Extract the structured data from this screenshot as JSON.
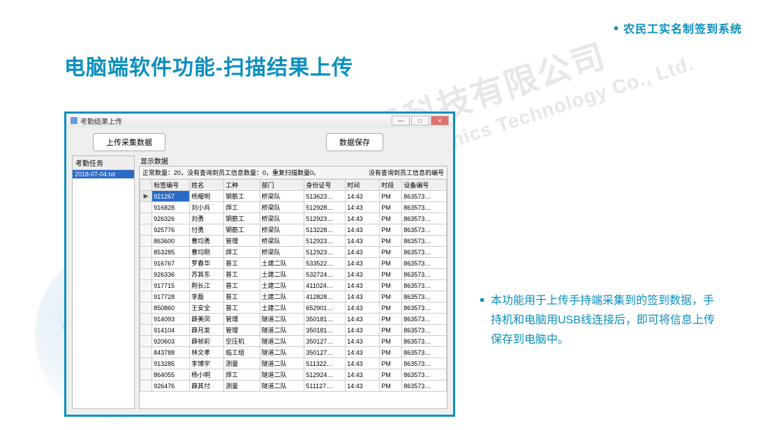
{
  "header": {
    "system_label": "农民工实名制签到系统",
    "page_title": "电脑端软件功能-扫描结果上传"
  },
  "watermark": {
    "cn": "陕西永辉电子科技有限公司",
    "en": "Shaanxi YongHui Electronics Technology Co., Ltd."
  },
  "app": {
    "window_title": "考勤结果上传",
    "btn_upload": "上传采集数据",
    "btn_save": "数据保存",
    "task_panel_header": "考勤任务",
    "task_file": "2018-07-04.txt",
    "display_label": "显示数据",
    "summary_left": "正常数量：20，没有查询到员工信息数量：0，重复扫描数量0。",
    "summary_right": "没有查询到员工信息的编号",
    "columns": [
      "标签编号",
      "姓名",
      "工种",
      "部门",
      "身份证号",
      "时间",
      "时段",
      "设备编号"
    ],
    "rows": [
      {
        "id": "921267",
        "name": "杨耀明",
        "trade": "钢筋工",
        "dept": "桥梁队",
        "idno": "513623…",
        "time": "14:43",
        "seg": "PM",
        "dev": "863573…"
      },
      {
        "id": "916828",
        "name": "刘小兵",
        "trade": "焊工",
        "dept": "桥梁队",
        "idno": "512928…",
        "time": "14:43",
        "seg": "PM",
        "dev": "863573…"
      },
      {
        "id": "926326",
        "name": "刘勇",
        "trade": "钢筋工",
        "dept": "桥梁队",
        "idno": "512923…",
        "time": "14:43",
        "seg": "PM",
        "dev": "863573…"
      },
      {
        "id": "925776",
        "name": "付勇",
        "trade": "钢筋工",
        "dept": "桥梁队",
        "idno": "513228…",
        "time": "14:43",
        "seg": "PM",
        "dev": "863573…"
      },
      {
        "id": "863600",
        "name": "曹均勇",
        "trade": "管理",
        "dept": "桥梁队",
        "idno": "512923…",
        "time": "14:43",
        "seg": "PM",
        "dev": "863573…"
      },
      {
        "id": "853285",
        "name": "曹均刚",
        "trade": "焊工",
        "dept": "桥梁队",
        "idno": "512923…",
        "time": "14:43",
        "seg": "PM",
        "dev": "863573…"
      },
      {
        "id": "916767",
        "name": "罗春华",
        "trade": "普工",
        "dept": "土建二队",
        "idno": "533522…",
        "time": "14:43",
        "seg": "PM",
        "dev": "863573…"
      },
      {
        "id": "926336",
        "name": "苏其东",
        "trade": "普工",
        "dept": "土建二队",
        "idno": "532724…",
        "time": "14:43",
        "seg": "PM",
        "dev": "863573…"
      },
      {
        "id": "917715",
        "name": "荆长江",
        "trade": "普工",
        "dept": "土建二队",
        "idno": "411024…",
        "time": "14:43",
        "seg": "PM",
        "dev": "863573…"
      },
      {
        "id": "917728",
        "name": "李磊",
        "trade": "普工",
        "dept": "土建二队",
        "idno": "412828…",
        "time": "14:43",
        "seg": "PM",
        "dev": "863573…"
      },
      {
        "id": "850860",
        "name": "王安全",
        "trade": "普工",
        "dept": "土建二队",
        "idno": "652901…",
        "time": "14:43",
        "seg": "PM",
        "dev": "863573…"
      },
      {
        "id": "914093",
        "name": "薛美凤",
        "trade": "管理",
        "dept": "隧道二队",
        "idno": "350181…",
        "time": "14:43",
        "seg": "PM",
        "dev": "863573…"
      },
      {
        "id": "914104",
        "name": "薛月发",
        "trade": "管理",
        "dept": "隧道二队",
        "idno": "350181…",
        "time": "14:43",
        "seg": "PM",
        "dev": "863573…"
      },
      {
        "id": "920603",
        "name": "薛祯彩",
        "trade": "空压机",
        "dept": "隧道二队",
        "idno": "350127…",
        "time": "14:43",
        "seg": "PM",
        "dev": "863573…"
      },
      {
        "id": "843788",
        "name": "林文孝",
        "trade": "临工组",
        "dept": "隧道二队",
        "idno": "350127…",
        "time": "14:43",
        "seg": "PM",
        "dev": "863573…"
      },
      {
        "id": "913285",
        "name": "李博宇",
        "trade": "测量",
        "dept": "隧道二队",
        "idno": "511322…",
        "time": "14:43",
        "seg": "PM",
        "dev": "863573…"
      },
      {
        "id": "864055",
        "name": "杨小明",
        "trade": "焊工",
        "dept": "隧道二队",
        "idno": "512924…",
        "time": "14:43",
        "seg": "PM",
        "dev": "863573…"
      },
      {
        "id": "926476",
        "name": "薛其付",
        "trade": "测量",
        "dept": "隧道二队",
        "idno": "511127…",
        "time": "14:43",
        "seg": "PM",
        "dev": "863573…"
      }
    ]
  },
  "description": "本功能用于上传手持端采集到的签到数据，手持机和电脑用USB线连接后，即可将信息上传保存到电脑中。"
}
